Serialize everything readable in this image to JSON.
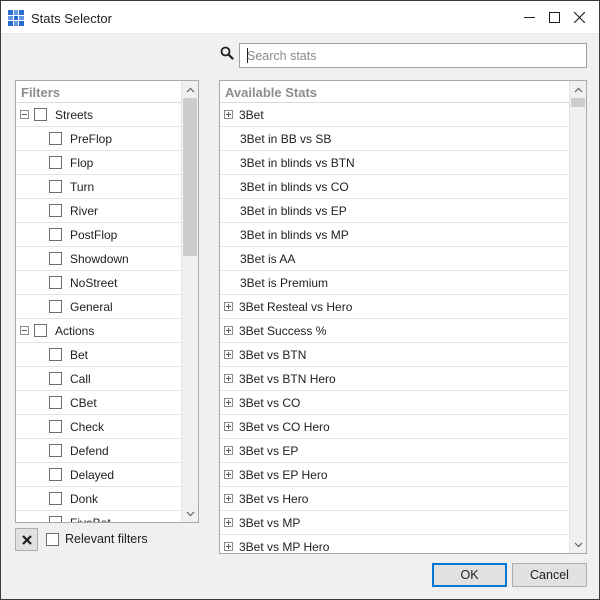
{
  "window": {
    "title": "Stats Selector"
  },
  "search": {
    "placeholder": "Search stats",
    "value": ""
  },
  "filters": {
    "header": "Filters",
    "groups": [
      {
        "label": "Streets",
        "children": [
          "PreFlop",
          "Flop",
          "Turn",
          "River",
          "PostFlop",
          "Showdown",
          "NoStreet",
          "General"
        ]
      },
      {
        "label": "Actions",
        "children": [
          "Bet",
          "Call",
          "CBet",
          "Check",
          "Defend",
          "Delayed",
          "Donk",
          "FiveBet"
        ]
      }
    ]
  },
  "stats": {
    "header": "Available Stats",
    "items": [
      {
        "label": "3Bet",
        "expandable": true
      },
      {
        "label": "3Bet in BB vs SB",
        "expandable": false
      },
      {
        "label": "3Bet in blinds vs BTN",
        "expandable": false
      },
      {
        "label": "3Bet in blinds vs CO",
        "expandable": false
      },
      {
        "label": "3Bet in blinds vs EP",
        "expandable": false
      },
      {
        "label": "3Bet in blinds vs MP",
        "expandable": false
      },
      {
        "label": "3Bet is AA",
        "expandable": false
      },
      {
        "label": "3Bet is Premium",
        "expandable": false
      },
      {
        "label": "3Bet Resteal vs Hero",
        "expandable": true
      },
      {
        "label": "3Bet Success %",
        "expandable": true
      },
      {
        "label": "3Bet vs BTN",
        "expandable": true
      },
      {
        "label": "3Bet vs BTN Hero",
        "expandable": true
      },
      {
        "label": "3Bet vs CO",
        "expandable": true
      },
      {
        "label": "3Bet vs CO Hero",
        "expandable": true
      },
      {
        "label": "3Bet vs EP",
        "expandable": true
      },
      {
        "label": "3Bet vs EP Hero",
        "expandable": true
      },
      {
        "label": "3Bet vs Hero",
        "expandable": true
      },
      {
        "label": "3Bet vs MP",
        "expandable": true
      },
      {
        "label": "3Bet vs MP Hero",
        "expandable": true
      }
    ]
  },
  "footer": {
    "relevant_filters_label": "Relevant filters",
    "ok_label": "OK",
    "cancel_label": "Cancel"
  },
  "icons": {
    "app": "grid-app-icon",
    "minimize": "minimize-icon",
    "maximize": "maximize-icon",
    "close": "close-icon",
    "search": "search-icon",
    "clear": "clear-x-icon"
  },
  "colors": {
    "default_button_border": "#0078d7",
    "panel_header_text": "#8d8d8d"
  }
}
